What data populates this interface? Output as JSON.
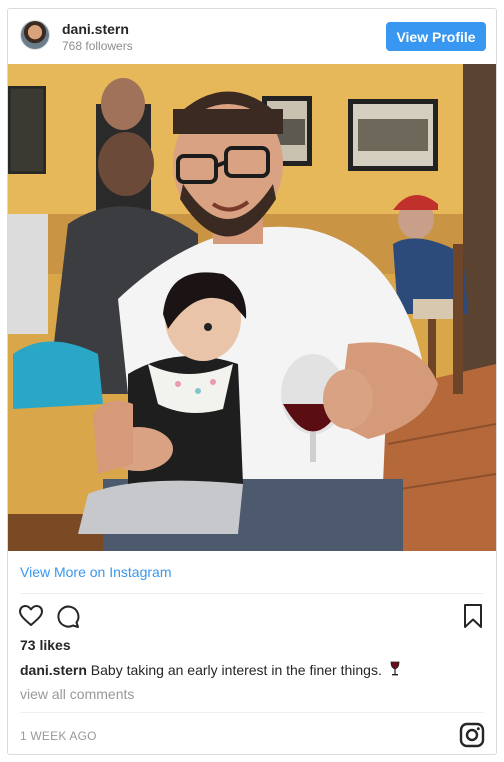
{
  "header": {
    "username": "dani.stern",
    "followers": "768 followers",
    "view_profile_label": "View Profile"
  },
  "links": {
    "view_more": "View More on Instagram"
  },
  "post": {
    "likes": "73 likes",
    "caption_user": "dani.stern",
    "caption_text": "Baby taking an early interest in the finer things.",
    "view_comments": "view all comments",
    "timestamp": "1 WEEK AGO"
  },
  "colors": {
    "accent": "#3897f0",
    "muted": "#999999"
  },
  "icons": [
    "heart-icon",
    "comment-icon",
    "bookmark-icon",
    "wine-glass-emoji",
    "instagram-icon"
  ]
}
